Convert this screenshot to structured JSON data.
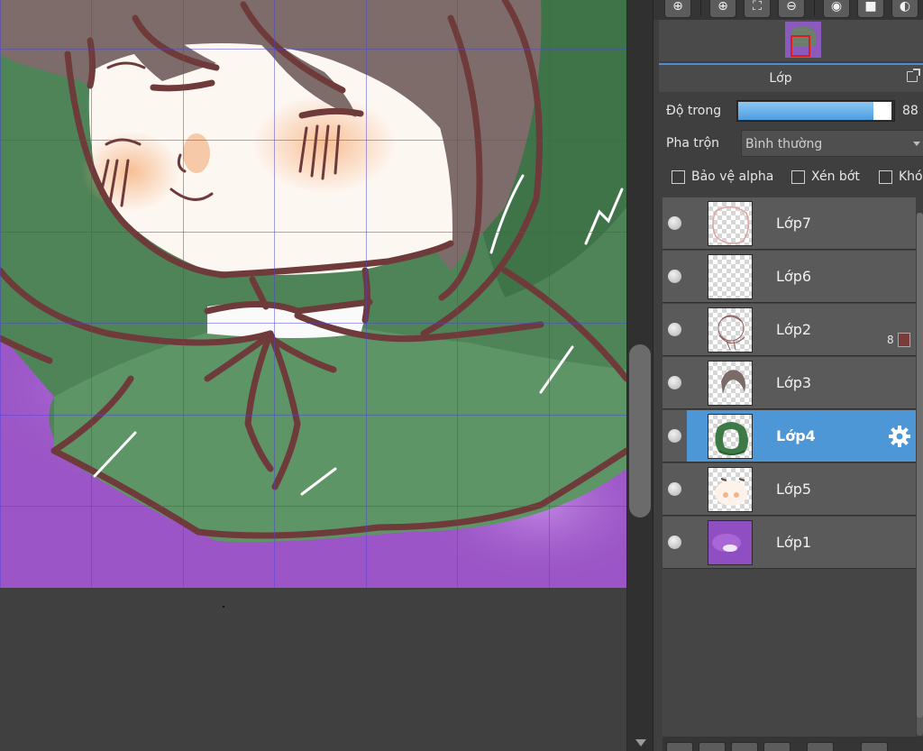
{
  "panel": {
    "layer_title": "Lớp",
    "opacity": {
      "label": "Độ trong",
      "value": "88",
      "fraction": 0.88
    },
    "blend": {
      "label": "Pha trộn",
      "value": "Bình thường"
    },
    "checkboxes": [
      {
        "label": "Bảo vệ alpha",
        "checked": false
      },
      {
        "label": "Xén bớt",
        "checked": false
      },
      {
        "label": "Khó",
        "checked": false
      }
    ]
  },
  "layers": [
    {
      "name": "Lớp7",
      "visible": true,
      "selected": false,
      "thumb": "sketch-outline"
    },
    {
      "name": "Lớp6",
      "visible": true,
      "selected": false,
      "thumb": "empty"
    },
    {
      "name": "Lớp2",
      "visible": true,
      "selected": false,
      "thumb": "line-art",
      "clip_count": "8",
      "clip_color": "#7a3b3b"
    },
    {
      "name": "Lớp3",
      "visible": true,
      "selected": false,
      "thumb": "hair"
    },
    {
      "name": "Lớp4",
      "visible": true,
      "selected": true,
      "thumb": "green-cloak"
    },
    {
      "name": "Lớp5",
      "visible": true,
      "selected": false,
      "thumb": "skin"
    },
    {
      "name": "Lớp1",
      "visible": true,
      "selected": false,
      "thumb": "purple-background"
    }
  ],
  "toolbar_icons": [
    "zoom-in-icon",
    "zoom-in-plus-icon",
    "fit-screen-icon",
    "zoom-out-icon",
    "rotate-icon",
    "flip-icon",
    "reset-icon"
  ],
  "colors": {
    "accent": "#4d97d6",
    "canvas_bg": "#404040",
    "panel_bg": "#3f3f3f",
    "cloak": "#3e7a45",
    "background_purple": "#9b55c6",
    "line": "#6e3a3a"
  }
}
